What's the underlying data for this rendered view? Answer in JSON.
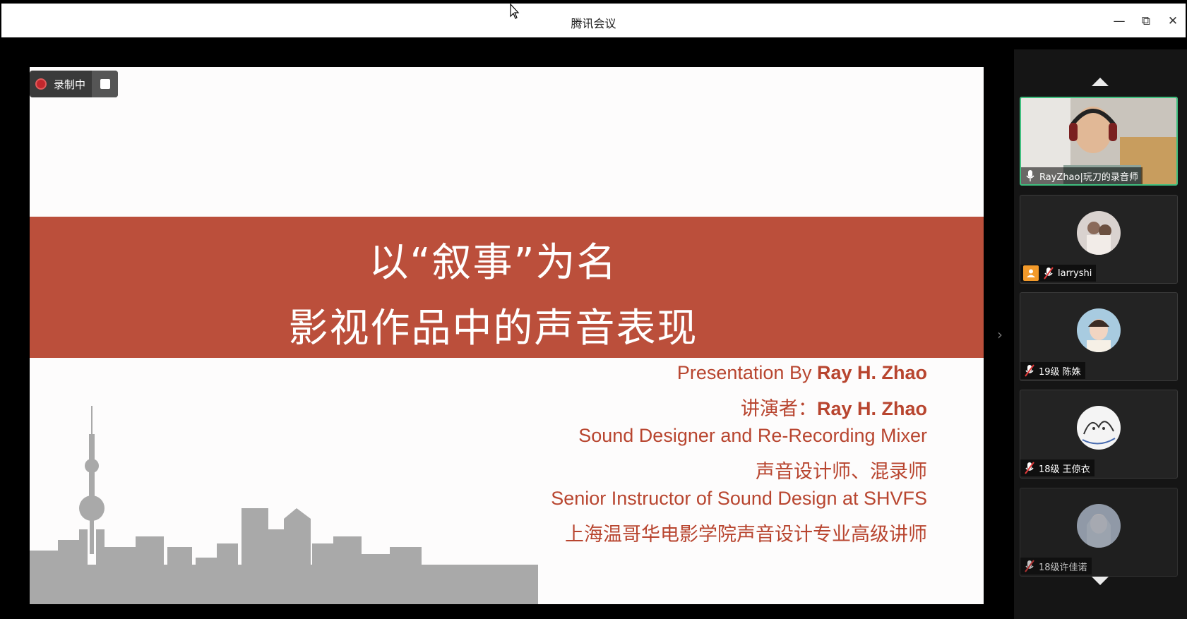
{
  "window": {
    "title": "腾讯会议",
    "minimize_symbol": "—",
    "restore_symbol": "⧉",
    "close_symbol": "✕"
  },
  "recording": {
    "label": "录制中"
  },
  "slide": {
    "title_line1": "以“叙事”为名",
    "title_line2": "影视作品中的声音表现",
    "credits": [
      {
        "prefix": "Presentation By ",
        "bold": "Ray H. Zhao"
      },
      {
        "prefix": "讲演者：",
        "bold": "Ray H. Zhao"
      },
      {
        "prefix": "Sound Designer and Re-Recording Mixer",
        "bold": ""
      },
      {
        "prefix": "声音设计师、混录师",
        "bold": ""
      },
      {
        "prefix": "Senior Instructor of Sound Design at SHVFS",
        "bold": ""
      },
      {
        "prefix": "上海温哥华电影学院声音设计专业高级讲师",
        "bold": ""
      }
    ]
  },
  "participants": [
    {
      "name": "RayZhao|玩刀的录音师",
      "mic": "on",
      "active": true,
      "video": true
    },
    {
      "name": "larryshi",
      "mic": "muted",
      "host": true
    },
    {
      "name": "19级 陈姝",
      "mic": "muted"
    },
    {
      "name": "18级 王倞衣",
      "mic": "muted"
    },
    {
      "name": "18级许佳诺",
      "mic": "muted"
    }
  ],
  "colors": {
    "banner": "#bb4f3b",
    "credit_text": "#b8452f",
    "active_speaker_border": "#3fbf7f",
    "host_badge": "#f39a2a",
    "recording_dot": "#c2272d"
  },
  "icons": {
    "panel_toggle": "›"
  }
}
